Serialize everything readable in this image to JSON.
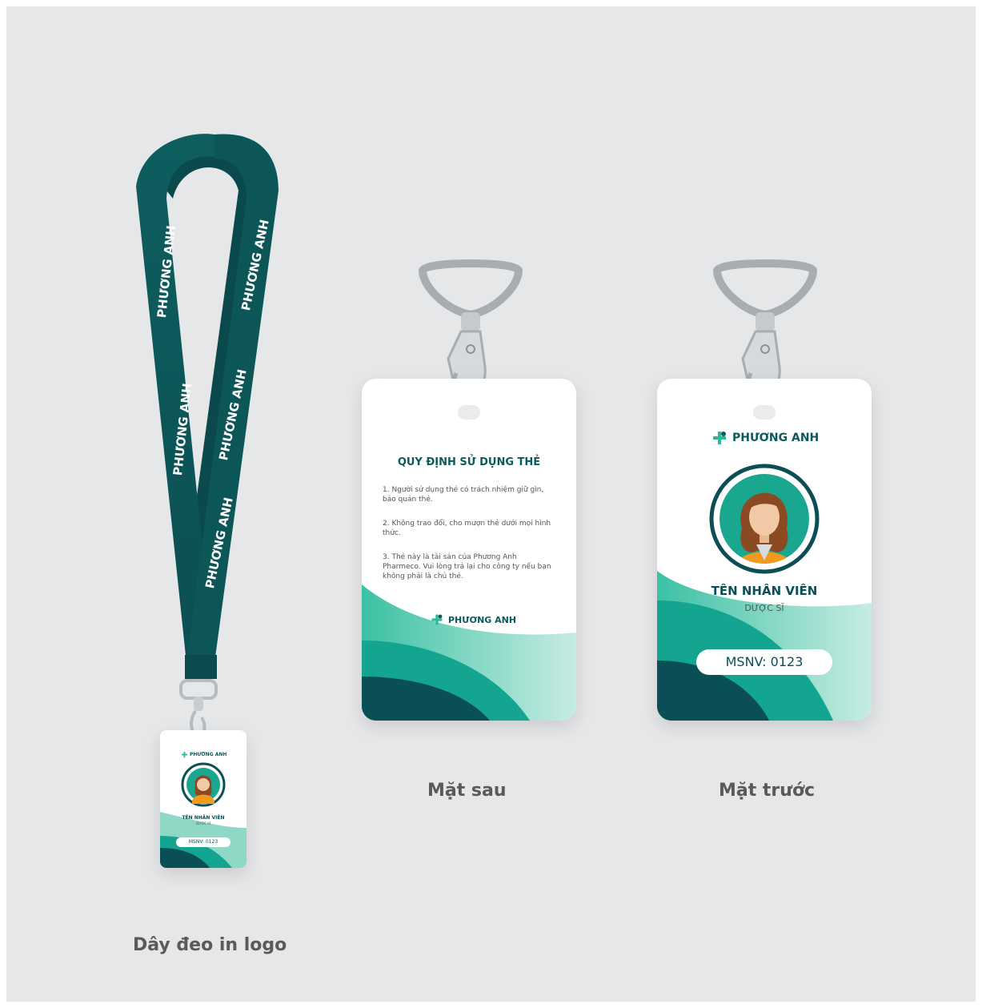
{
  "brand": {
    "name": "PHƯƠNG ANH",
    "logo_icon": "plus-leaf-logo-icon",
    "color": "#0b5a5c",
    "accent": "#3cc1a4"
  },
  "captions": {
    "lanyard": "Dây đeo in logo",
    "back": "Mặt sau",
    "front": "Mặt trước"
  },
  "back_card": {
    "title": "QUY ĐỊNH SỬ DỤNG THẺ",
    "rules": [
      "1. Người sử dụng thẻ có trách nhiệm giữ gìn, bảo quản thẻ.",
      "2. Không trao đổi, cho mượn thẻ dưới mọi hình thức.",
      "3. Thẻ này là tài sản của Phương Anh Pharmeco. Vui lòng trả lại cho công ty nếu bạn không phải là chủ thẻ."
    ]
  },
  "front_card": {
    "employee_name": "TÊN NHÂN VIÊN",
    "role": "DƯỢC SĨ",
    "msnv": "MSNV: 0123",
    "avatar_icon": "woman-avatar-icon"
  },
  "colors": {
    "background": "#e6e7e9",
    "strap": "#0d5658",
    "wave_dark": "#0a4f55",
    "wave_mid": "#13a58f",
    "wave_light": "#a8e0d4"
  }
}
